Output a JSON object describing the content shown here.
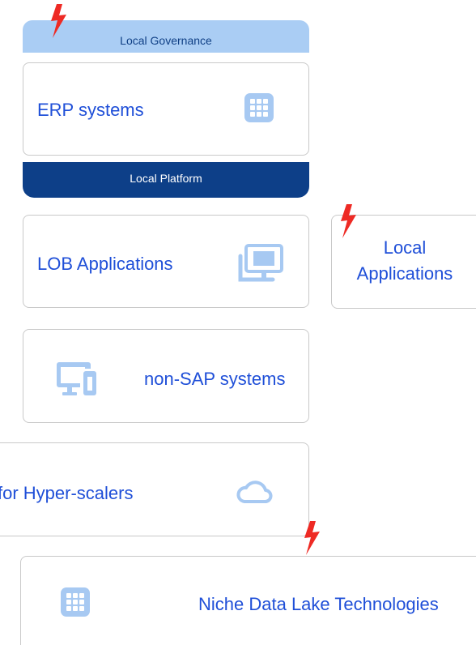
{
  "local_governance": {
    "label": "Local Governance"
  },
  "erp": {
    "label": "ERP systems",
    "icon": "grid-icon"
  },
  "local_platform": {
    "label": "Local Platform"
  },
  "lob": {
    "label": "LOB Applications",
    "icon": "monitor-icon"
  },
  "local_apps": {
    "label_line1": "Local",
    "label_line2": "Applications"
  },
  "non_sap": {
    "label": "non-SAP systems",
    "icon": "devices-icon"
  },
  "hyperscalers": {
    "label": "for Hyper-scalers",
    "icon": "cloud-icon"
  },
  "niche": {
    "label": "Niche Data Lake Technologies",
    "icon": "grid-icon"
  },
  "colors": {
    "accent_text": "#1f4fd8",
    "icon_blue": "#a7c9f2",
    "governance_band": "#aacdf4",
    "platform_band": "#0d3f88",
    "lightning_red": "#ee2a24",
    "card_border": "#c9c9c9"
  }
}
